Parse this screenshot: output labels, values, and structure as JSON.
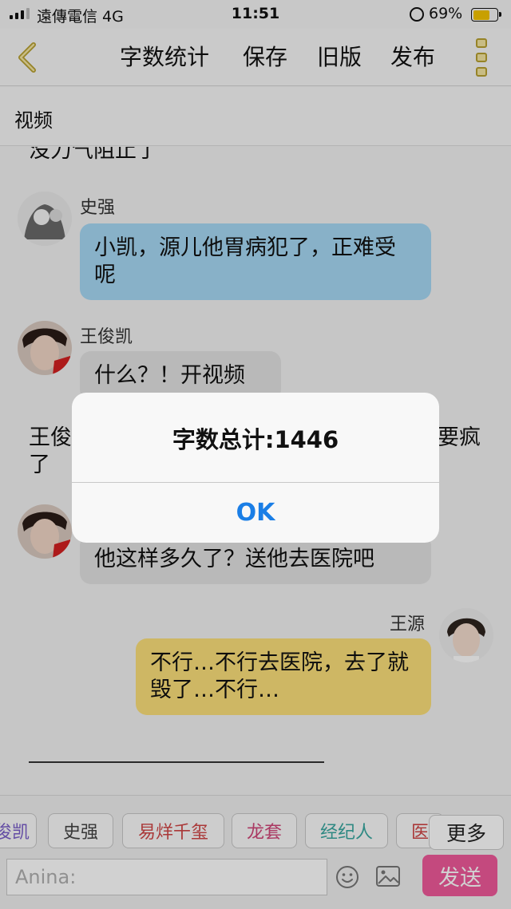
{
  "status_bar": {
    "carrier": "遠傳電信   4G",
    "time": "11:51",
    "battery_percent": "69%",
    "battery_level": 0.69
  },
  "nav": {
    "actions": [
      "字数统计",
      "保存",
      "旧版",
      "发布"
    ]
  },
  "section_title": "视频",
  "chat": {
    "top_narration": "没力气阻止了",
    "messages": [
      {
        "sender": "史强",
        "text": "小凯，源儿他胃病犯了，正难受呢",
        "color": "#a6d8f5"
      },
      {
        "sender": "王俊凯",
        "text": "什么？！开视频",
        "color": "#e2e2e2"
      },
      {
        "sender": "",
        "text": "他这样多久了？送他去医院吧",
        "color": "#e2e2e2"
      },
      {
        "sender": "王源",
        "text": "不行…不行去医院，去了就毁了…不行…",
        "color": "#fce07a"
      }
    ],
    "narration_left": "王俊",
    "narration_right": "要疯",
    "narration_wrap": "了"
  },
  "chips": [
    "俊凯",
    "史强",
    "易烊千玺",
    "龙套",
    "经纪人",
    "医"
  ],
  "chip_colors": [
    "#7a5fc9",
    "#444444",
    "#d04646",
    "#d04678",
    "#3aa8a0",
    "#d04646"
  ],
  "more_label": "更多",
  "input": {
    "placeholder": "Anina:"
  },
  "send_label": "发送",
  "alert": {
    "title": "字数总计:1446",
    "button": "OK"
  }
}
